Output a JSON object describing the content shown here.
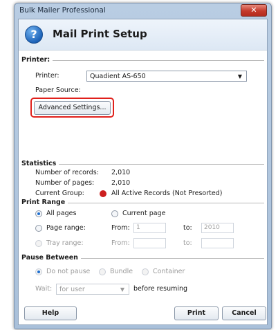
{
  "window": {
    "title": "Bulk Mailer Professional",
    "close_glyph": "✕"
  },
  "header": {
    "title": "Mail Print Setup",
    "icon": "question-icon",
    "icon_glyph": "?"
  },
  "printer_section": {
    "heading": "Printer:",
    "printer_label": "Printer:",
    "printer_value": "Quadient AS-650",
    "paper_source_label": "Paper Source:",
    "advanced_button": "Advanced Settings..."
  },
  "statistics": {
    "heading": "Statistics",
    "records_label": "Number of records:",
    "records_value": "2,010",
    "pages_label": "Number of pages:",
    "pages_value": "2,010",
    "group_label": "Current Group:",
    "group_value": "All Active Records (Not Presorted)",
    "group_color": "#cc1f1f"
  },
  "print_range": {
    "heading": "Print Range",
    "all_pages": "All pages",
    "current_page": "Current page",
    "page_range": "Page range:",
    "tray_range": "Tray range:",
    "from_label": "From:",
    "to_label": "to:",
    "page_from_value": "1",
    "page_to_value": "2010",
    "tray_from_label": "From:",
    "tray_to_label": "to:",
    "selected": "all_pages"
  },
  "pause_between": {
    "heading": "Pause Between",
    "do_not_pause": "Do not pause",
    "bundle": "Bundle",
    "container": "Container",
    "wait_label": "Wait:",
    "wait_value": "for user",
    "before_resuming": "before resuming"
  },
  "footer": {
    "help": "Help",
    "print": "Print",
    "cancel": "Cancel"
  },
  "colors": {
    "accent": "#1e6fd0",
    "highlight": "#e0201b"
  }
}
